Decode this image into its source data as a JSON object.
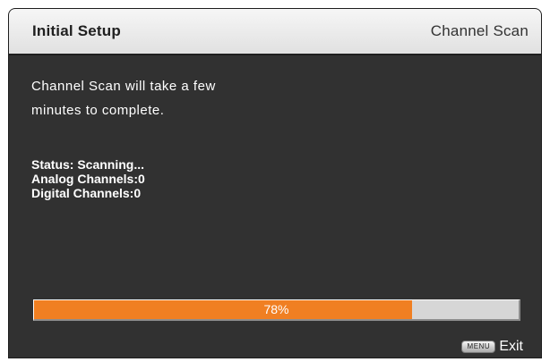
{
  "header": {
    "title": "Initial Setup",
    "screen": "Channel Scan"
  },
  "main": {
    "message_line1": "Channel Scan will take a few",
    "message_line2": "minutes to complete.",
    "status": "Status: Scanning...",
    "analog_channels": "Analog Channels:0",
    "digital_channels": "Digital Channels:0"
  },
  "progress": {
    "value": 0.78,
    "label": "78%"
  },
  "footer": {
    "menu_key_label": "MENU",
    "exit_label": "Exit"
  },
  "colors": {
    "panel_bg": "#313131",
    "header_bg": "#e8e8e8",
    "progress_fill": "#f07f22",
    "progress_track": "#d6d6d6"
  }
}
